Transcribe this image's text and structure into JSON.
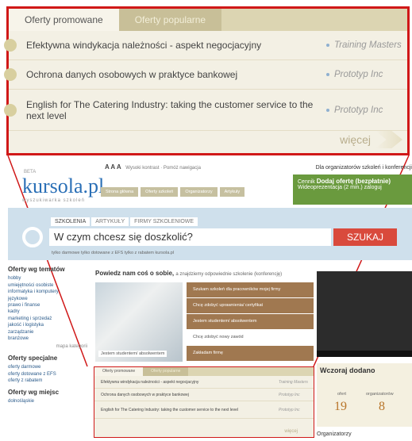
{
  "zoomed": {
    "tabs": [
      "Oferty promowane",
      "Oferty popularne"
    ],
    "rows": [
      {
        "title": "Efektywna windykacja należności - aspekt negocjacyjny",
        "company": "Training Masters"
      },
      {
        "title": "Ochrona danych osobowych w praktyce bankowej",
        "company": "Prototyp Inc"
      },
      {
        "title": "English for The Catering Industry: taking the customer service to the next level",
        "company": "Prototyp Inc"
      }
    ],
    "more": "więcej"
  },
  "site": {
    "logo": "kursola.pl",
    "logo_beta": "BETA",
    "logo_sub": "wyszukiwarka szkoleń",
    "toptools": {
      "aaa": "A A A",
      "contrast": "Wysoki kontrast",
      "help": "Pomóż nawigacja"
    },
    "crumbs": [
      "Strona główna",
      "Oferty szkoleń",
      "Organizatorzy",
      "Artykuły"
    ],
    "org_title": "Dla organizatorów szkoleń i konferencji",
    "org_box": {
      "cennik": "Cennik",
      "cta": "Dodaj ofertę (bezpłatnie)",
      "sub": "Wideoprezentacja (2 min.)",
      "login": "zaloguj"
    },
    "search": {
      "tabs": [
        "SZKOLENIA",
        "ARTYKUŁY",
        "FIRMY SZKOLENIOWE"
      ],
      "placeholder": "W czym chcesz się doszkolić?",
      "button": "SZUKAJ",
      "filters": "tylko darmowe   tylko dotowane z EFS   tylko z rabatem kursola.pl"
    },
    "left": {
      "heading1": "Oferty wg tematów",
      "topics": [
        "hobby",
        "umiejętności osobiste",
        "informatyka i komputery",
        "językowe",
        "prawo i finanse",
        "kadry",
        "marketing i sprzedaż",
        "jakość i logistyka",
        "zarządzanie",
        "branżowe"
      ],
      "more": "mapa kategorii",
      "heading2": "Oferty specjalne",
      "specials": [
        "oferty darmowe",
        "oferty dotowane z EFS",
        "oferty z rabatem"
      ],
      "heading3": "Oferty wg miejsc",
      "places": [
        "dolnośląskie"
      ]
    },
    "hero": {
      "title": "Powiedz nam coś o sobie,",
      "subtitle": "a znajdziemy odpowiednie szkolenie (konferencję)",
      "caption": "Jestem studentem/ absolwentem",
      "options": [
        "Szukam szkoleń dla pracowników mojej firmy",
        "Chcę zdobyć uprawnienia/ certyfikat",
        "Jestem studentem/ absolwentem",
        "Chcę zdobyć nowy zawód",
        "Zakładam firmę"
      ]
    },
    "wczoraj": {
      "title": "Wczoraj dodano",
      "label1": "ofert",
      "value1": "19",
      "label2": "organizatorów",
      "value2": "8"
    },
    "org_footer": "Organizatorzy"
  }
}
